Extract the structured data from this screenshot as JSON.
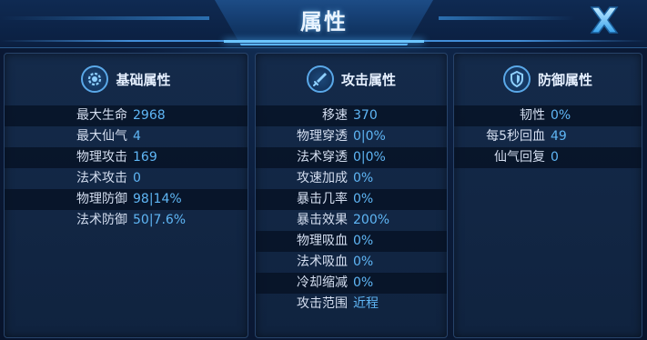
{
  "title": "属性",
  "panels": {
    "basic": {
      "title": "基础属性",
      "icon": "gear-icon",
      "rows": [
        {
          "label": "最大生命",
          "value": "2968"
        },
        {
          "label": "最大仙气",
          "value": "4"
        },
        {
          "label": "物理攻击",
          "value": "169"
        },
        {
          "label": "法术攻击",
          "value": "0"
        },
        {
          "label": "物理防御",
          "value": "98|14%"
        },
        {
          "label": "法术防御",
          "value": "50|7.6%"
        }
      ]
    },
    "attack": {
      "title": "攻击属性",
      "icon": "sword-icon",
      "rows": [
        {
          "label": "移速",
          "value": "370"
        },
        {
          "label": "物理穿透",
          "value": "0|0%"
        },
        {
          "label": "法术穿透",
          "value": "0|0%"
        },
        {
          "label": "攻速加成",
          "value": "0%"
        },
        {
          "label": "暴击几率",
          "value": "0%"
        },
        {
          "label": "暴击效果",
          "value": "200%"
        },
        {
          "label": "物理吸血",
          "value": "0%"
        },
        {
          "label": "法术吸血",
          "value": "0%"
        },
        {
          "label": "冷却缩减",
          "value": "0%"
        },
        {
          "label": "攻击范围",
          "value": "近程"
        }
      ]
    },
    "defense": {
      "title": "防御属性",
      "icon": "shield-icon",
      "rows": [
        {
          "label": "韧性",
          "value": "0%"
        },
        {
          "label": "每5秒回血",
          "value": "49"
        },
        {
          "label": "仙气回复",
          "value": "0"
        }
      ]
    }
  },
  "colors": {
    "value": "#5fb6f5",
    "label": "#d4def0",
    "accent": "#6cc6ff"
  }
}
